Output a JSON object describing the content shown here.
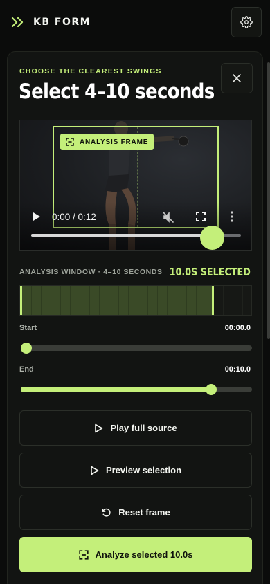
{
  "app": {
    "name": "KB FORM"
  },
  "panel": {
    "eyebrow": "CHOOSE THE CLEAREST SWINGS",
    "title": "Select 4–10 seconds"
  },
  "video": {
    "frame_tag": "ANALYSIS FRAME",
    "time": "0:00 / 0:12",
    "progress_fraction": 0.86
  },
  "analysis_window": {
    "label": "ANALYSIS WINDOW · 4–10 SECONDS",
    "selected": "10.0S SELECTED",
    "selection_fraction": 0.833
  },
  "range": {
    "start": {
      "label": "Start",
      "value": "00:00.0",
      "fraction": 0.0
    },
    "end": {
      "label": "End",
      "value": "00:10.0",
      "fraction": 0.833
    }
  },
  "buttons": {
    "play_full": "Play full source",
    "preview": "Preview selection",
    "reset": "Reset frame",
    "analyze": "Analyze selected 10.0s"
  },
  "colors": {
    "accent": "#c4ef7a",
    "background": "#0b0c0b",
    "panel": "#121412"
  },
  "icons": [
    "chevrons-right-icon",
    "gear-icon",
    "close-icon",
    "frame-corners-icon",
    "play-icon",
    "mute-icon",
    "fullscreen-icon",
    "more-vertical-icon",
    "rotate-ccw-icon"
  ]
}
